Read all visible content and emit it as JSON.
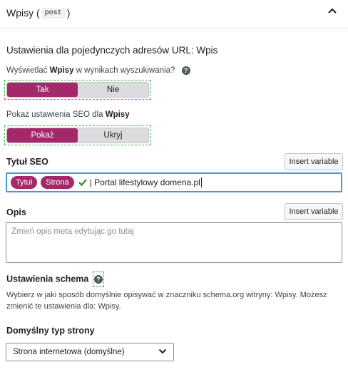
{
  "header": {
    "title_prefix": "Wpisy (",
    "post_type": "post",
    "title_suffix": ")"
  },
  "settings_section": {
    "title": "Ustawienia dla pojedynczych adresów URL: Wpis"
  },
  "search_visibility": {
    "question_prefix": "Wyświetlać ",
    "question_bold": "Wpisy",
    "question_suffix": " w wynikach wyszukiwania?",
    "options": [
      "Tak",
      "Nie"
    ],
    "selected": "Tak"
  },
  "seo_settings": {
    "question_prefix": "Pokaż ustawienia SEO dla ",
    "question_bold": "Wpisy",
    "options": [
      "Pokaż",
      "Ukryj"
    ],
    "selected": "Pokaż"
  },
  "seo_title": {
    "label": "Tytuł SEO",
    "insert_variable_label": "Insert variable",
    "variables": [
      "Tytuł",
      "Strona"
    ],
    "text": "| Portal lifestylowy domena.pl"
  },
  "description": {
    "label": "Opis",
    "insert_variable_label": "Insert variable",
    "placeholder": "Zmień opis meta edytując go tutaj"
  },
  "schema": {
    "label": "Ustawienia schema",
    "description": "Wybierz w jaki sposób domyślnie opisywać w znaczniku schema.org witryny: Wpisy. Możesz zmienić te ustawienia dla: Wpisy."
  },
  "page_type": {
    "label": "Domyślny typ strony",
    "selected": "Strona internetowa (domyślne)"
  },
  "colors": {
    "accent": "#a4286a",
    "focus_border": "#4f94d4",
    "check_green": "#2e8b2e"
  }
}
